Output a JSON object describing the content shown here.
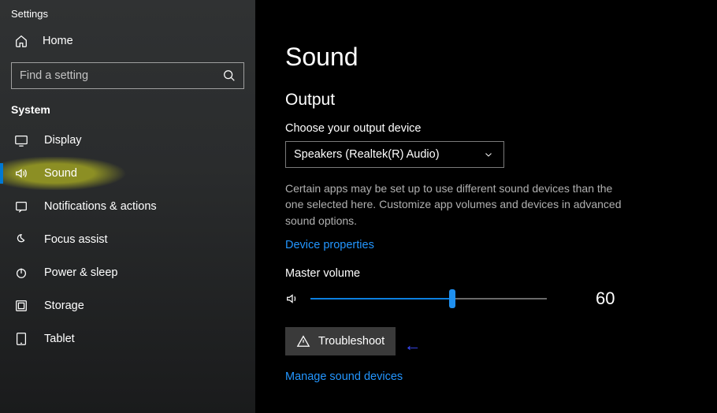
{
  "window": {
    "title": "Settings"
  },
  "sidebar": {
    "home_label": "Home",
    "search_placeholder": "Find a setting",
    "section_label": "System",
    "items": [
      {
        "label": "Display"
      },
      {
        "label": "Sound"
      },
      {
        "label": "Notifications & actions"
      },
      {
        "label": "Focus assist"
      },
      {
        "label": "Power & sleep"
      },
      {
        "label": "Storage"
      },
      {
        "label": "Tablet"
      }
    ]
  },
  "main": {
    "page_title": "Sound",
    "output_heading": "Output",
    "choose_label": "Choose your output device",
    "selected_device": "Speakers (Realtek(R) Audio)",
    "description": "Certain apps may be set up to use different sound devices than the one selected here. Customize app volumes and devices in advanced sound options.",
    "device_properties_link": "Device properties",
    "master_volume_label": "Master volume",
    "master_volume_value": "60",
    "master_volume_percent": 60,
    "troubleshoot_label": "Troubleshoot",
    "manage_devices_link": "Manage sound devices"
  },
  "colors": {
    "accent": "#0078d4",
    "link": "#2396ff",
    "highlight": "#8c8f24"
  }
}
